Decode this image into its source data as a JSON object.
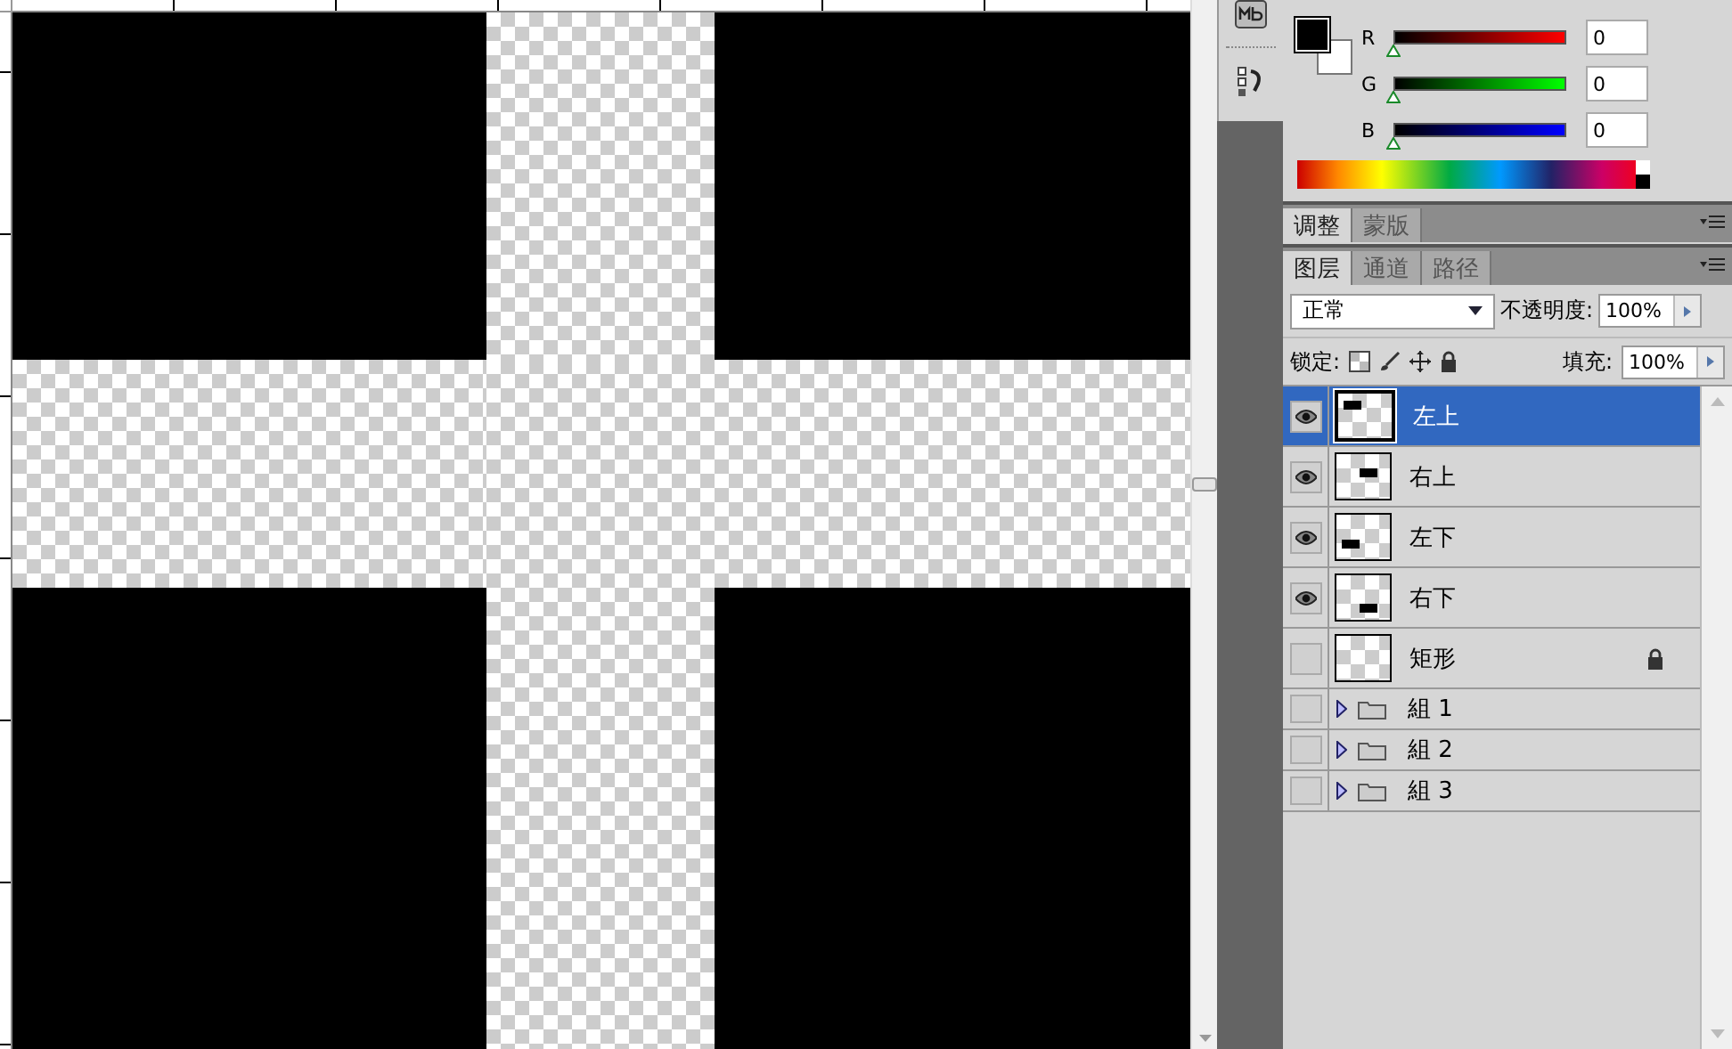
{
  "color_panel": {
    "channels": [
      {
        "label": "R",
        "value": "0",
        "level": 0
      },
      {
        "label": "G",
        "value": "0",
        "level": 0
      },
      {
        "label": "B",
        "value": "0",
        "level": 0
      }
    ]
  },
  "adjust_tabs": [
    {
      "label": "调整",
      "selected": true
    },
    {
      "label": "蒙版",
      "selected": false
    }
  ],
  "layer_tabs": [
    {
      "label": "图层",
      "selected": true
    },
    {
      "label": "通道",
      "selected": false
    },
    {
      "label": "路径",
      "selected": false
    }
  ],
  "blend_mode": "正常",
  "opacity_label": "不透明度:",
  "opacity": "100%",
  "lock_label": "锁定:",
  "fill_label": "填充:",
  "fill": "100%",
  "layers": [
    {
      "kind": "layer",
      "name": "左上",
      "visible": true,
      "selected": true,
      "locked": false
    },
    {
      "kind": "layer",
      "name": "右上",
      "visible": true,
      "selected": false,
      "locked": false
    },
    {
      "kind": "layer",
      "name": "左下",
      "visible": true,
      "selected": false,
      "locked": false
    },
    {
      "kind": "layer",
      "name": "右下",
      "visible": true,
      "selected": false,
      "locked": false
    },
    {
      "kind": "layer",
      "name": "矩形",
      "visible": false,
      "selected": false,
      "locked": true
    },
    {
      "kind": "group",
      "name": "組 1",
      "visible": false,
      "selected": false,
      "expanded": false
    },
    {
      "kind": "group",
      "name": "組 2",
      "visible": false,
      "selected": false,
      "expanded": false
    },
    {
      "kind": "group",
      "name": "組 3",
      "visible": false,
      "selected": false,
      "expanded": false
    }
  ]
}
